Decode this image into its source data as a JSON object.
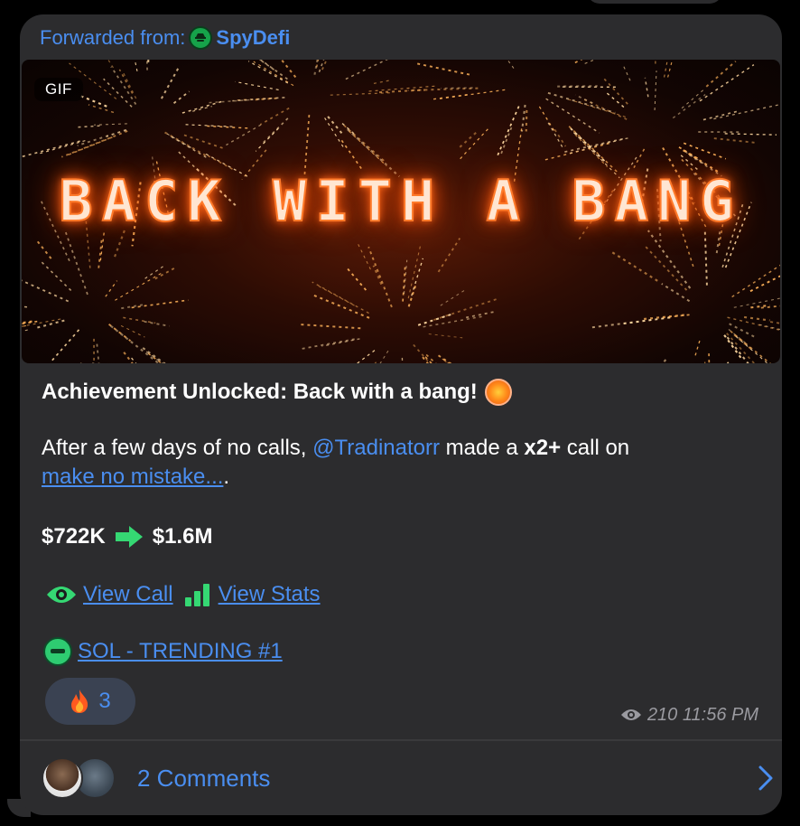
{
  "forwarded": {
    "prefix": "Forwarded from:",
    "channel": "SpyDefi"
  },
  "gif": {
    "badge": "GIF",
    "banner_text": "BACK WITH A BANG"
  },
  "message": {
    "headline": "Achievement Unlocked: Back with a bang!",
    "headline_emoji": "collision-icon",
    "line1_before": "After a few days of no calls, ",
    "mention": "@Tradinatorr",
    "line1_middle": " made a ",
    "multiplier": "x2+",
    "line1_after": " call on",
    "token_link": "make no mistake...",
    "line2_after": ".",
    "price_from": "$722K",
    "price_to": "$1.6M",
    "view_call": "View Call",
    "view_stats": "View Stats",
    "trending": "SOL - TRENDING #1"
  },
  "reaction": {
    "emoji": "fire-icon",
    "count": "3"
  },
  "meta": {
    "views": "210",
    "time": "11:56 PM"
  },
  "comments": {
    "label": "2 Comments"
  },
  "colors": {
    "bubble": "#2c2c2e",
    "link": "#4a8ef0",
    "accent_green": "#2ecc71",
    "reaction_bg": "#3a4252",
    "meta": "#9a9aa0"
  }
}
